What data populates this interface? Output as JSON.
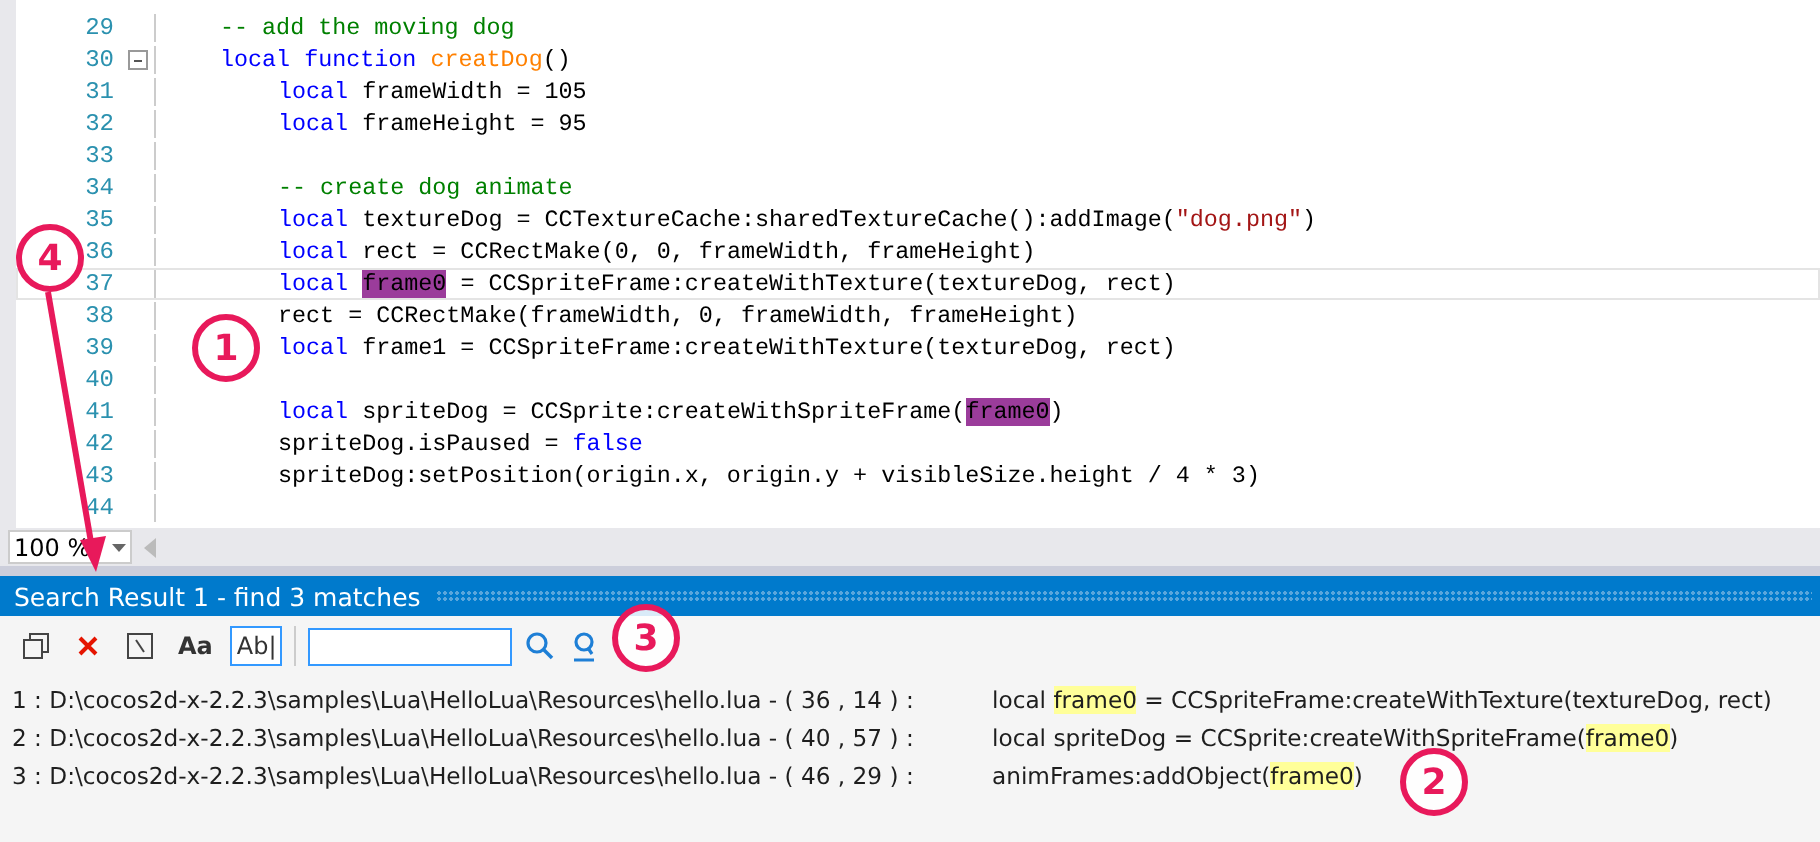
{
  "editor": {
    "lines": [
      {
        "number": "29",
        "fold": false,
        "current": false,
        "segments": [
          {
            "kind": "comment",
            "text": "-- add the moving dog"
          }
        ]
      },
      {
        "number": "30",
        "fold": true,
        "current": false,
        "segments": [
          {
            "kind": "keyword",
            "text": "local function "
          },
          {
            "kind": "function",
            "text": "creatDog"
          },
          {
            "kind": "plain",
            "text": "()"
          }
        ],
        "children": [
          {
            "number": "31",
            "fold": false,
            "current": false,
            "segments": [
              {
                "kind": "keyword",
                "text": "local"
              },
              {
                "kind": "plain",
                "text": " frameWidth = 105"
              }
            ]
          },
          {
            "number": "32",
            "fold": false,
            "current": false,
            "segments": [
              {
                "kind": "keyword",
                "text": "local"
              },
              {
                "kind": "plain",
                "text": " frameHeight = 95"
              }
            ]
          },
          {
            "number": "33",
            "fold": false,
            "current": false
          },
          {
            "number": "34",
            "fold": false,
            "current": false,
            "segments": [
              {
                "kind": "comment",
                "text": "-- create dog animate"
              }
            ]
          },
          {
            "number": "35",
            "fold": false,
            "current": false,
            "segments": [
              {
                "kind": "keyword",
                "text": "local"
              },
              {
                "kind": "plain",
                "text": " textureDog = CCTextureCache:sharedTextureCache():addImage("
              },
              {
                "kind": "string",
                "text": "\"dog.png\""
              },
              {
                "kind": "plain",
                "text": ")"
              }
            ]
          },
          {
            "number": "36",
            "fold": false,
            "current": false,
            "segments": [
              {
                "kind": "keyword",
                "text": "local"
              },
              {
                "kind": "plain",
                "text": " rect = CCRectMake(0, 0, frameWidth, frameHeight)"
              }
            ]
          },
          {
            "number": "37",
            "fold": false,
            "current": true,
            "segments": [
              {
                "kind": "keyword",
                "text": "local "
              },
              {
                "kind": "match",
                "text": "frame0"
              },
              {
                "kind": "plain",
                "text": " = CCSpriteFrame:createWithTexture(textureDog, rect)"
              }
            ]
          },
          {
            "number": "38",
            "fold": false,
            "current": false,
            "segments": [
              {
                "kind": "plain",
                "text": "rect = CCRectMake(frameWidth, 0, frameWidth, frameHeight)"
              }
            ]
          },
          {
            "number": "39",
            "fold": false,
            "current": false,
            "segments": [
              {
                "kind": "keyword",
                "text": "local"
              },
              {
                "kind": "plain",
                "text": " frame1 = CCSpriteFrame:createWithTexture(textureDog, rect)"
              }
            ]
          },
          {
            "number": "40",
            "fold": false,
            "current": false
          },
          {
            "number": "41",
            "fold": false,
            "current": false,
            "segments": [
              {
                "kind": "keyword",
                "text": "local"
              },
              {
                "kind": "plain",
                "text": " spriteDog = CCSprite:createWithSpriteFrame("
              },
              {
                "kind": "match",
                "text": "frame0"
              },
              {
                "kind": "plain",
                "text": ")"
              }
            ]
          },
          {
            "number": "42",
            "fold": false,
            "current": false,
            "segments": [
              {
                "kind": "plain",
                "text": "spriteDog.isPaused = "
              },
              {
                "kind": "keyword",
                "text": "false"
              }
            ]
          },
          {
            "number": "43",
            "fold": false,
            "current": false,
            "segments": [
              {
                "kind": "plain",
                "text": "spriteDog:setPosition(origin.x, origin.y + visibleSize.height / 4 * 3)"
              }
            ]
          },
          {
            "number": "44",
            "fold": false,
            "current": false
          }
        ]
      }
    ],
    "zoom": "100 %"
  },
  "search_panel": {
    "title": "Search Result 1 - find 3 matches",
    "toolbar": [
      {
        "kind": "copy",
        "selected": false
      },
      {
        "kind": "clear",
        "selected": false
      },
      {
        "kind": "regex",
        "selected": false
      },
      {
        "kind": "case",
        "label": "Aa",
        "selected": false
      },
      {
        "kind": "word",
        "label": "Ab|",
        "selected": true
      }
    ],
    "results": [
      {
        "location": "1 : D:\\cocos2d-x-2.2.3\\samples\\Lua\\HelloLua\\Resources\\hello.lua - ( 36 , 14 ) :",
        "segments": [
          {
            "match": false,
            "text": "local "
          },
          {
            "match": true,
            "text": "frame0"
          },
          {
            "match": false,
            "text": " = CCSpriteFrame:createWithTexture(textureDog, rect)"
          }
        ]
      },
      {
        "location": "2 : D:\\cocos2d-x-2.2.3\\samples\\Lua\\HelloLua\\Resources\\hello.lua - ( 40 , 57 ) :",
        "segments": [
          {
            "match": false,
            "text": "local spriteDog = CCSprite:createWithSpriteFrame("
          },
          {
            "match": true,
            "text": "frame0"
          },
          {
            "match": false,
            "text": ")"
          }
        ]
      },
      {
        "location": "3 : D:\\cocos2d-x-2.2.3\\samples\\Lua\\HelloLua\\Resources\\hello.lua - ( 46 , 29 ) :",
        "segments": [
          {
            "match": false,
            "text": "animFrames:addObject("
          },
          {
            "match": true,
            "text": "frame0"
          },
          {
            "match": false,
            "text": ")"
          }
        ]
      }
    ]
  },
  "annotations": [
    {
      "label": "1"
    },
    {
      "label": "2"
    },
    {
      "label": "3"
    },
    {
      "label": "4"
    }
  ]
}
